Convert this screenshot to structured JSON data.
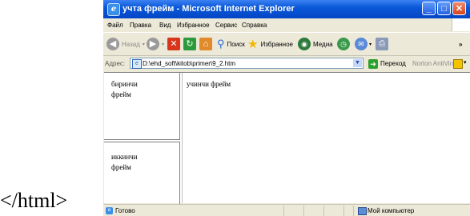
{
  "caption": "</html>",
  "window": {
    "title": "учта фрейм - Microsoft Internet Explorer",
    "buttons": {
      "minimize": "_",
      "maximize": "□",
      "close": "✕"
    }
  },
  "menu": [
    "Файл",
    "Правка",
    "Вид",
    "Избранное",
    "Сервис",
    "Справка"
  ],
  "toolbar": {
    "back": "Назад",
    "search": "Поиск",
    "favorites": "Избранное",
    "media": "Медиа"
  },
  "address": {
    "label": "Адрес:",
    "url": "D:\\ehd_soft\\kitob\\primer\\9_2.htm",
    "go": "Переход",
    "norton": "Norton AntiVirus"
  },
  "frames": {
    "frame1": [
      "биринчи",
      "фрейм"
    ],
    "frame2": [
      "иккинчи",
      "фрейм"
    ],
    "frame3": "учинчи фрейм"
  },
  "status": {
    "text": "Готово",
    "zone": "Мой компьютер"
  }
}
